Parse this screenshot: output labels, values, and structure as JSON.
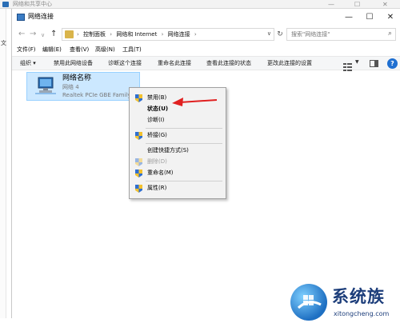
{
  "background_window": {
    "title": "网络和共享中心",
    "controls": [
      "—",
      "☐",
      "✕"
    ],
    "edge_text": "文"
  },
  "window": {
    "title": "网络连接",
    "controls": {
      "minimize": "—",
      "maximize": "☐",
      "close": "✕"
    }
  },
  "address_bar": {
    "breadcrumbs": [
      "控制面板",
      "网络和 Internet",
      "网络连接"
    ],
    "search_placeholder": "搜索\"网络连接\""
  },
  "menu": [
    "文件(F)",
    "编辑(E)",
    "查看(V)",
    "高级(N)",
    "工具(T)"
  ],
  "commands": [
    "组织 ▾",
    "禁用此网络设备",
    "诊断这个连接",
    "重命名此连接",
    "查看此连接的状态",
    "更改此连接的设置"
  ],
  "connection": {
    "name": "网络名称",
    "network": "网络  4",
    "adapter": "Realtek PCIe GBE Family Controller"
  },
  "context_menu": [
    {
      "label": "禁用(B)",
      "shield": true,
      "disabled": false
    },
    {
      "label": "状态(U)",
      "shield": false,
      "disabled": false
    },
    {
      "label": "诊断(I)",
      "shield": false,
      "disabled": false
    },
    {
      "label": "桥接(G)",
      "shield": true,
      "disabled": false
    },
    {
      "label": "创建快捷方式(S)",
      "shield": false,
      "disabled": false
    },
    {
      "label": "删除(D)",
      "shield": true,
      "disabled": true
    },
    {
      "label": "重命名(M)",
      "shield": true,
      "disabled": false
    },
    {
      "label": "属性(R)",
      "shield": true,
      "disabled": false
    }
  ],
  "watermark": {
    "brand": "系统族",
    "site": "xitongcheng.com"
  },
  "colors": {
    "selection": "#cce8ff",
    "arrow": "#e02020",
    "help": "#1f6fd1"
  }
}
